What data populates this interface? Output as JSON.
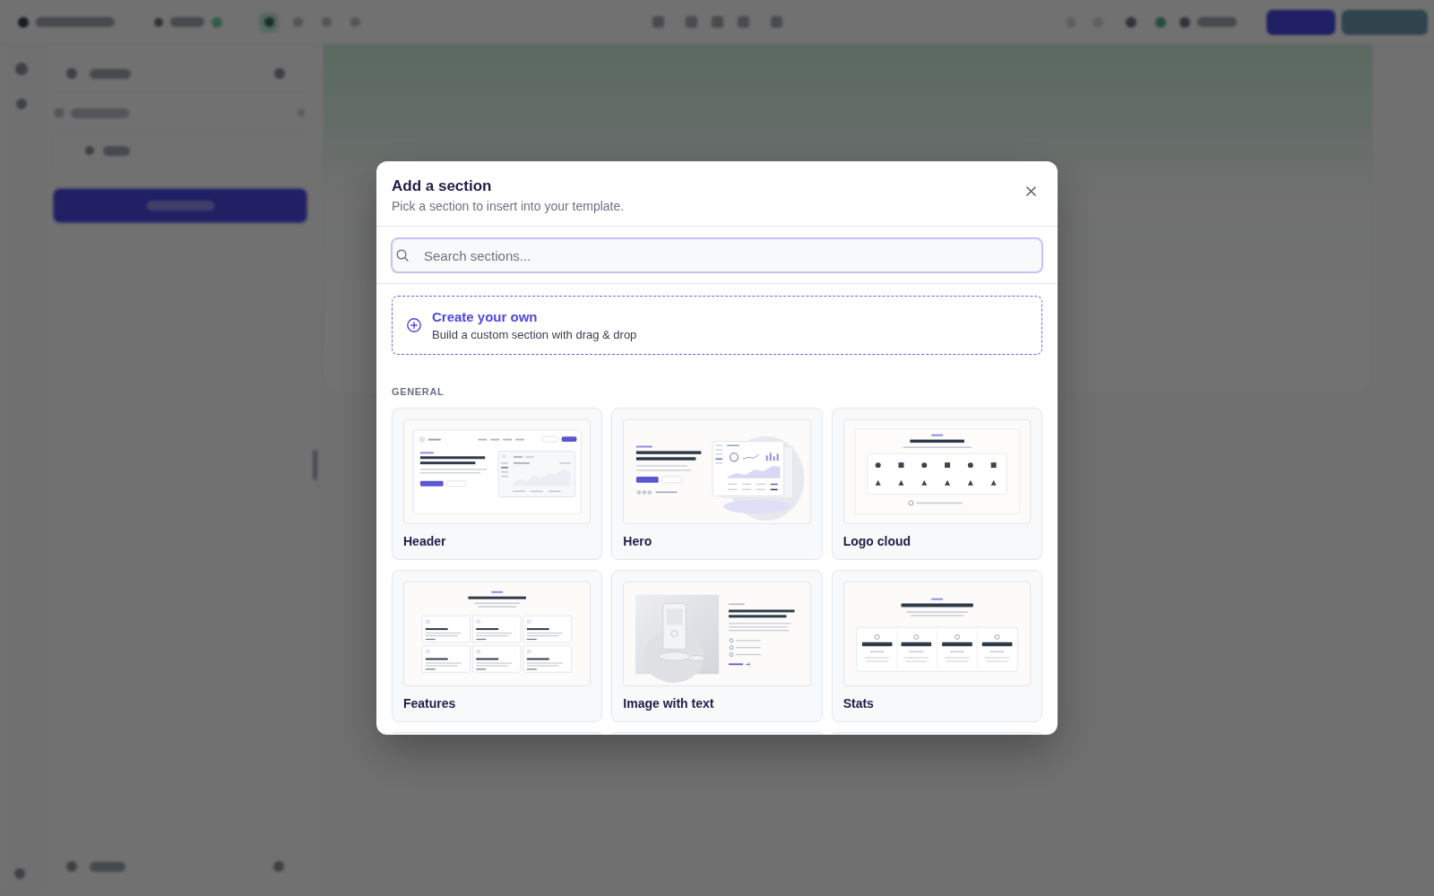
{
  "top_bar": {
    "tools": [
      {
        "selected": true
      },
      {
        "selected": false
      },
      {
        "selected": false
      },
      {
        "selected": false
      }
    ]
  },
  "dialog": {
    "title": "Add a section",
    "subtitle": "Pick a section to insert into your template.",
    "search": {
      "placeholder": "Search sections..."
    },
    "create_option": {
      "title": "Create your own",
      "description": "Build a custom section with drag & drop"
    },
    "groups": [
      {
        "label": "GENERAL",
        "cards": [
          {
            "label": "Header",
            "kind": "header"
          },
          {
            "label": "Hero",
            "kind": "hero"
          },
          {
            "label": "Logo cloud",
            "kind": "logo_cloud"
          },
          {
            "label": "Features",
            "kind": "features"
          },
          {
            "label": "Image with text",
            "kind": "image_text"
          },
          {
            "label": "Stats",
            "kind": "stats"
          }
        ]
      }
    ]
  }
}
